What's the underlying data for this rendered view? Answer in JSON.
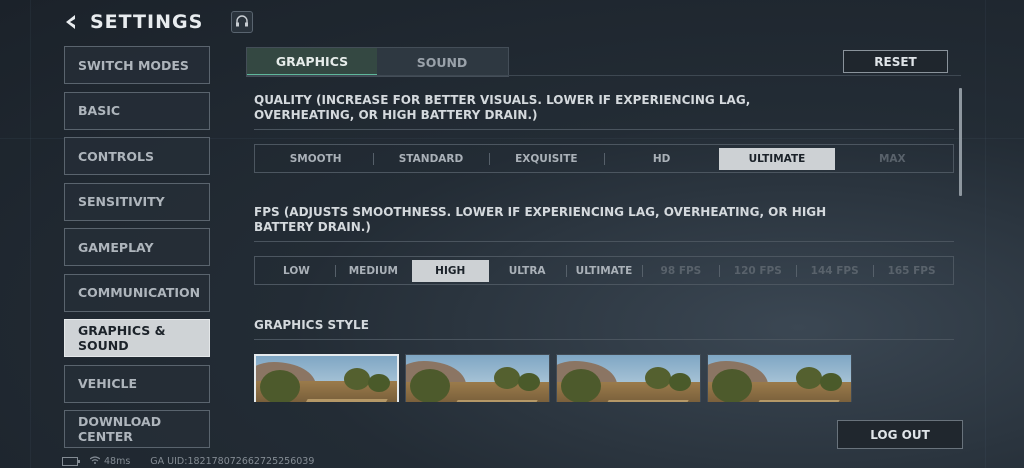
{
  "header": {
    "title": "SETTINGS"
  },
  "sidebar": {
    "items": [
      {
        "label": "SWITCH MODES"
      },
      {
        "label": "BASIC"
      },
      {
        "label": "CONTROLS"
      },
      {
        "label": "SENSITIVITY"
      },
      {
        "label": "GAMEPLAY"
      },
      {
        "label": "COMMUNICATION"
      },
      {
        "label": "GRAPHICS & SOUND",
        "active": true
      },
      {
        "label": "VEHICLE"
      },
      {
        "label": "DOWNLOAD CENTER"
      }
    ]
  },
  "tabs": [
    {
      "label": "GRAPHICS",
      "active": true
    },
    {
      "label": "SOUND"
    }
  ],
  "reset_label": "RESET",
  "quality": {
    "title": "QUALITY (INCREASE FOR BETTER VISUALS. LOWER IF EXPERIENCING LAG, OVERHEATING, OR HIGH BATTERY DRAIN.)",
    "options": [
      "SMOOTH",
      "STANDARD",
      "EXQUISITE",
      "HD",
      "ULTIMATE",
      "MAX"
    ],
    "selected": "ULTIMATE",
    "disabled": [
      "MAX"
    ]
  },
  "fps": {
    "title": "FPS (ADJUSTS SMOOTHNESS. LOWER IF EXPERIENCING LAG, OVERHEATING, OR HIGH BATTERY DRAIN.)",
    "options": [
      "LOW",
      "MEDIUM",
      "HIGH",
      "ULTRA",
      "ULTIMATE",
      "98 FPS",
      "120 FPS",
      "144 FPS",
      "165 FPS"
    ],
    "selected": "HIGH",
    "disabled": [
      "98 FPS",
      "120 FPS",
      "144 FPS",
      "165 FPS"
    ]
  },
  "graphics_style": {
    "title": "GRAPHICS STYLE",
    "selected_index": 0,
    "count": 4
  },
  "logout_label": "LOG OUT",
  "status_bar": {
    "ping": "48ms",
    "uid": "GA UID:182178072662725256039"
  },
  "colors": {
    "accent": "#5fb79c",
    "selected_bg": "#cdd1d4"
  }
}
